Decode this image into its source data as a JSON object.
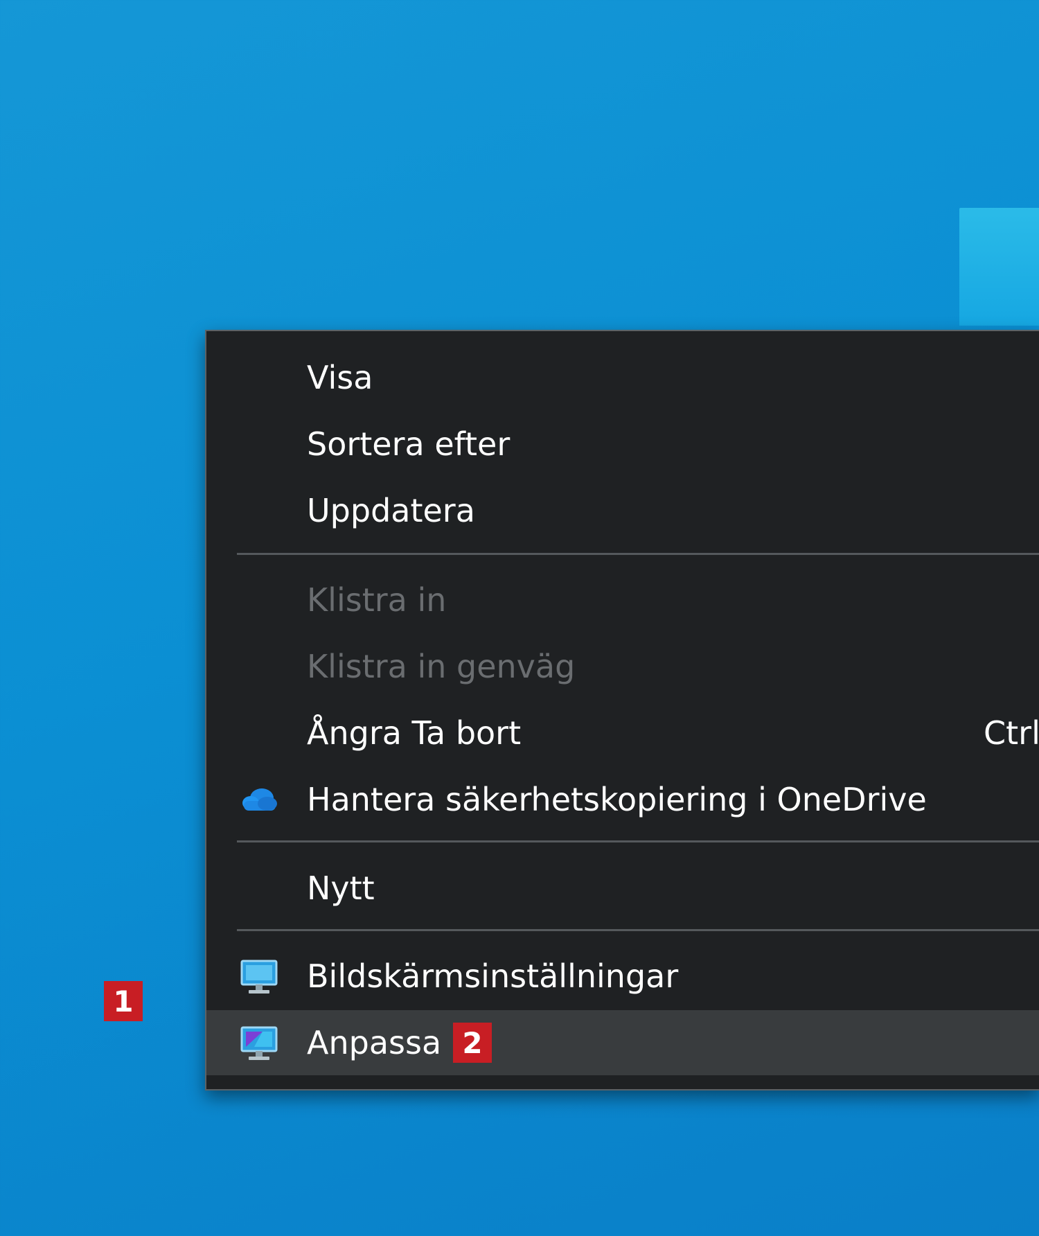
{
  "menu": {
    "items": [
      {
        "label": "Visa"
      },
      {
        "label": "Sortera efter"
      },
      {
        "label": "Uppdatera"
      },
      {
        "label": "Klistra in",
        "disabled": true
      },
      {
        "label": "Klistra in genväg",
        "disabled": true
      },
      {
        "label": "Ångra Ta bort",
        "shortcut": "Ctrl"
      },
      {
        "label": "Hantera säkerhetskopiering i OneDrive",
        "icon": "onedrive-cloud-icon"
      },
      {
        "label": "Nytt"
      },
      {
        "label": "Bildskärmsinställningar",
        "icon": "display-settings-icon"
      },
      {
        "label": "Anpassa",
        "icon": "personalize-icon",
        "highlighted": true
      }
    ]
  },
  "badges": {
    "one": "1",
    "two": "2"
  },
  "colors": {
    "menu_bg": "#1f2123",
    "highlight_bg": "#393c3e",
    "badge_red": "#c81e24",
    "desktop_blue": "#0b8fd3"
  }
}
